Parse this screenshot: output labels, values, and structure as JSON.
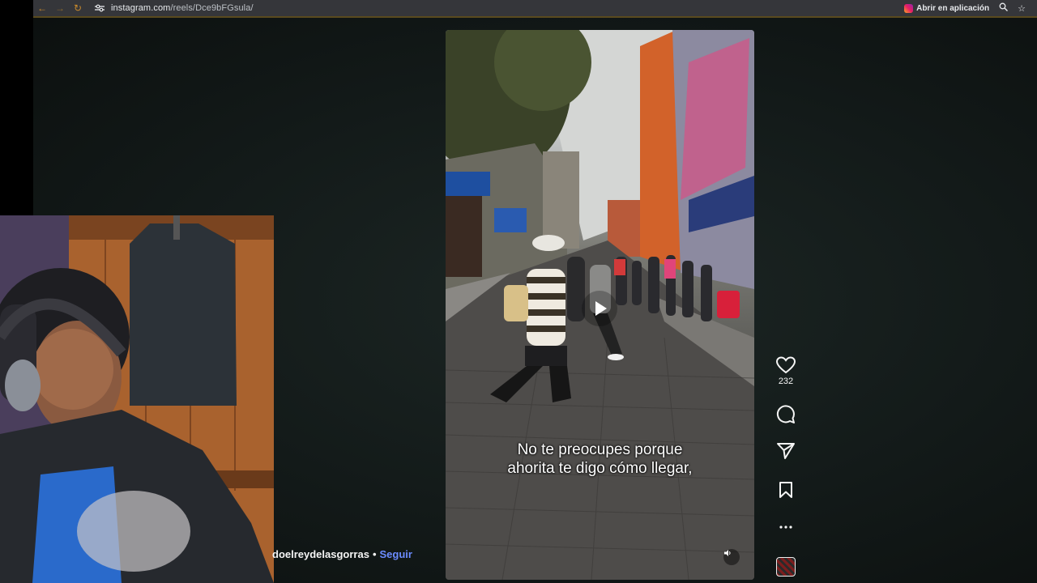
{
  "browser": {
    "url_host": "instagram.com",
    "url_path": "/reels/Dce9bFGsula/",
    "open_in_app_label": "Abrir en aplicación"
  },
  "reel": {
    "caption_line1": "No te preocupes porque",
    "caption_line2": "ahorita te digo cómo llegar,",
    "likes_count": "232",
    "author": "doelreydelasgorras",
    "separator": "•",
    "follow_label": "Seguir"
  },
  "icons": {
    "back": "arrow-left-icon",
    "forward": "arrow-right-icon",
    "reload": "reload-icon",
    "site_settings": "tune-icon",
    "zoom": "magnifier-icon",
    "bookmark_star": "star-icon",
    "like": "heart-icon",
    "comment": "comment-icon",
    "share": "send-icon",
    "save": "bookmark-icon",
    "more": "more-icon",
    "play": "play-icon",
    "audio": "speaker-icon"
  },
  "colors": {
    "follow_link": "#6c8cff",
    "browser_bar": "#35363a",
    "page_background": "#131a19"
  }
}
